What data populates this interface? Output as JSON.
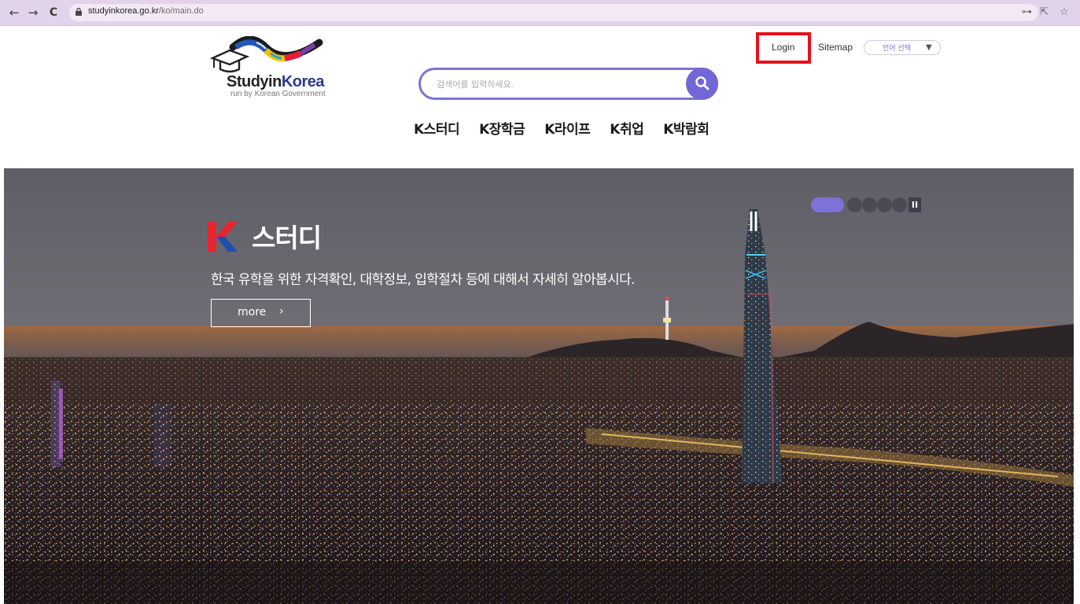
{
  "browser": {
    "back_icon": "←",
    "forward_icon": "→",
    "reload_icon": "C",
    "url_domain": "studyinkorea.go.kr",
    "url_path": "/ko/main.do",
    "key_icon": "⊶",
    "share_icon": "⇱",
    "star_icon": "☆"
  },
  "header": {
    "logo_word_1": "Studyin",
    "logo_word_2": "Korea",
    "logo_sub": "run by Korean Government",
    "login": "Login",
    "sitemap": "Sitemap",
    "language_select": "언어 선택",
    "caret": "▼",
    "search_placeholder": "검색어를 입력하세요."
  },
  "gnb": {
    "items": [
      "K스터디",
      "K장학금",
      "K라이프",
      "K취업",
      "K박람회"
    ]
  },
  "hero": {
    "title": "스터디",
    "description": "한국 유학을 위한 자격확인, 대학정보, 입학절차 등에 대해서 자세히 알아봅시다.",
    "more_label": "more",
    "more_arrow": "›",
    "pause_label": "II",
    "slide_count": 5,
    "active_slide": 1
  },
  "colors": {
    "accent": "#7d72d8",
    "highlight": "#e8101b",
    "chrome": "#e3d3ea"
  }
}
